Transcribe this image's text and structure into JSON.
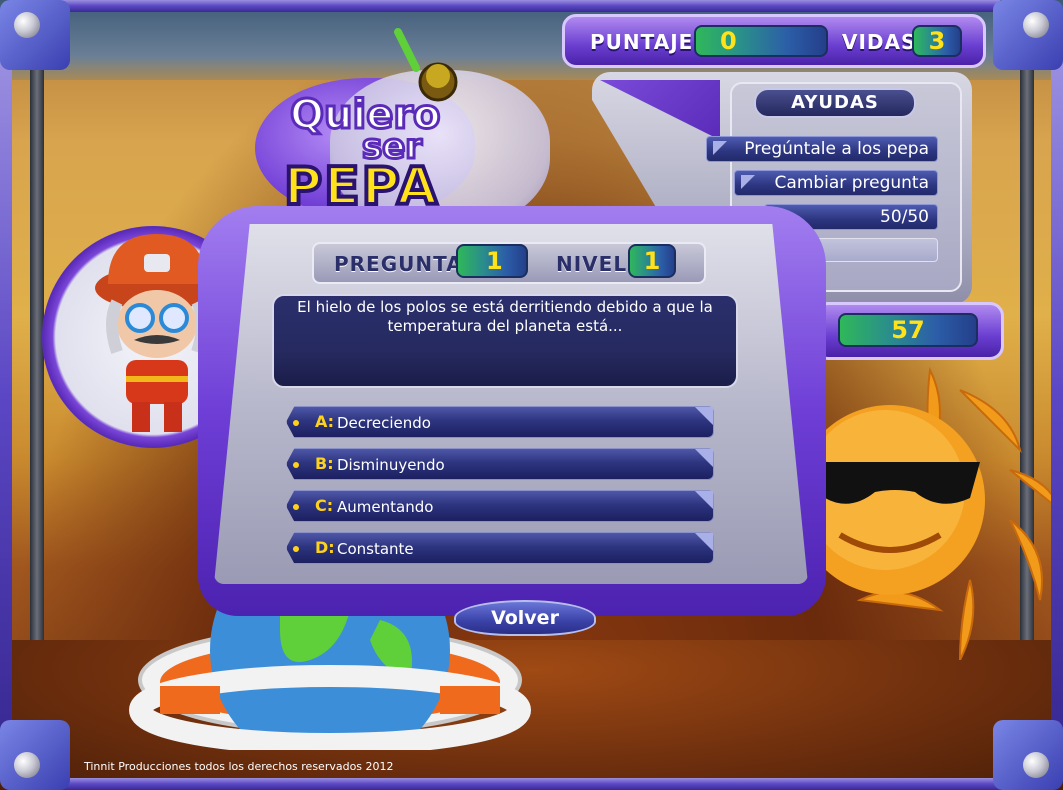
{
  "game": {
    "logo": {
      "line1": "Quiero",
      "line2": "ser",
      "line3": "PEPA"
    }
  },
  "hud": {
    "score_label": "PUNTAJE",
    "score_value": "0",
    "lives_label": "VIDAS",
    "lives_value": "3"
  },
  "helps": {
    "title": "AYUDAS",
    "items": [
      {
        "label": "Pregúntale a los pepa"
      },
      {
        "label": "Cambiar pregunta"
      },
      {
        "label": "50/50"
      },
      {
        "label": ""
      }
    ]
  },
  "timer": {
    "value": "57"
  },
  "question": {
    "number_label": "PREGUNTA",
    "number_value": "1",
    "level_label": "NIVEL",
    "level_value": "1",
    "text": "El hielo de los polos se está derritiendo debido a que la temperatura del planeta está..."
  },
  "answers": [
    {
      "letter": "A:",
      "text": "Decreciendo"
    },
    {
      "letter": "B:",
      "text": "Disminuyendo"
    },
    {
      "letter": "C:",
      "text": "Aumentando"
    },
    {
      "letter": "D:",
      "text": "Constante"
    }
  ],
  "nav": {
    "back_label": "Volver"
  },
  "footer": {
    "copyright": "Tinnit Producciones todos los derechos reservados 2012"
  },
  "colors": {
    "frame": "#5b47c4",
    "panel_purple": "#6e3ed6",
    "lcd_blue": "#2c5ea8",
    "lcd_green": "#2fb85a",
    "digit_yellow": "#ffe21a",
    "answer_letter": "#ffd21a"
  }
}
